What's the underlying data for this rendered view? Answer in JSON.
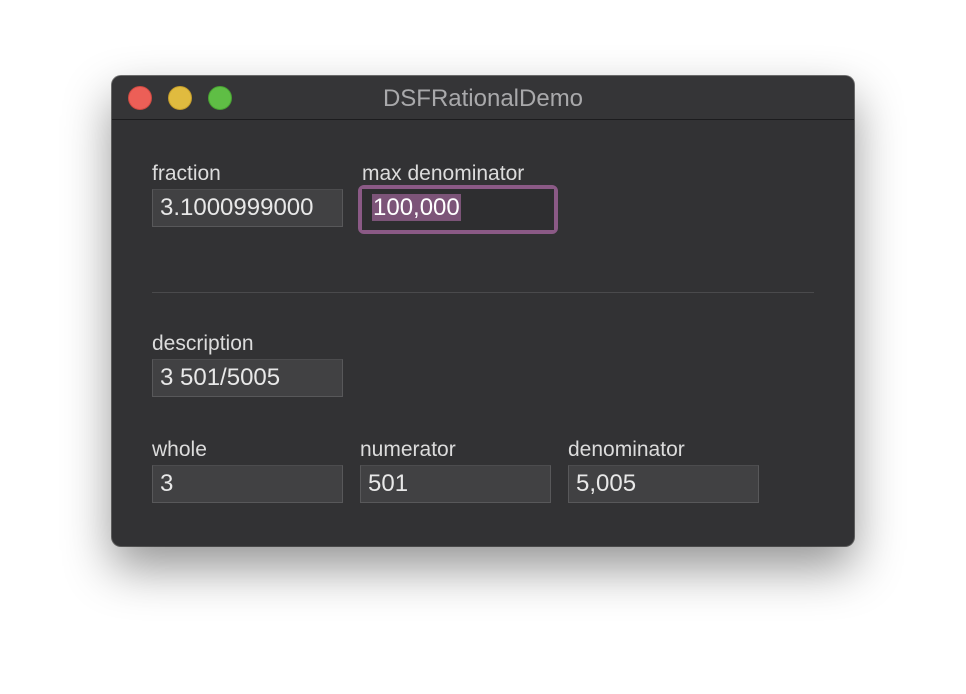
{
  "window": {
    "title": "DSFRationalDemo"
  },
  "inputs": {
    "fraction": {
      "label": "fraction",
      "value": "3.1000999000"
    },
    "max_denominator": {
      "label": "max denominator",
      "value": "100,000"
    }
  },
  "outputs": {
    "description": {
      "label": "description",
      "value": "3 501/5005"
    },
    "whole": {
      "label": "whole",
      "value": "3"
    },
    "numerator": {
      "label": "numerator",
      "value": "501"
    },
    "denominator": {
      "label": "denominator",
      "value": "5,005"
    }
  },
  "colors": {
    "focus_ring": "#8b5a86",
    "selection": "#7c5478",
    "window_background": "#323234"
  }
}
